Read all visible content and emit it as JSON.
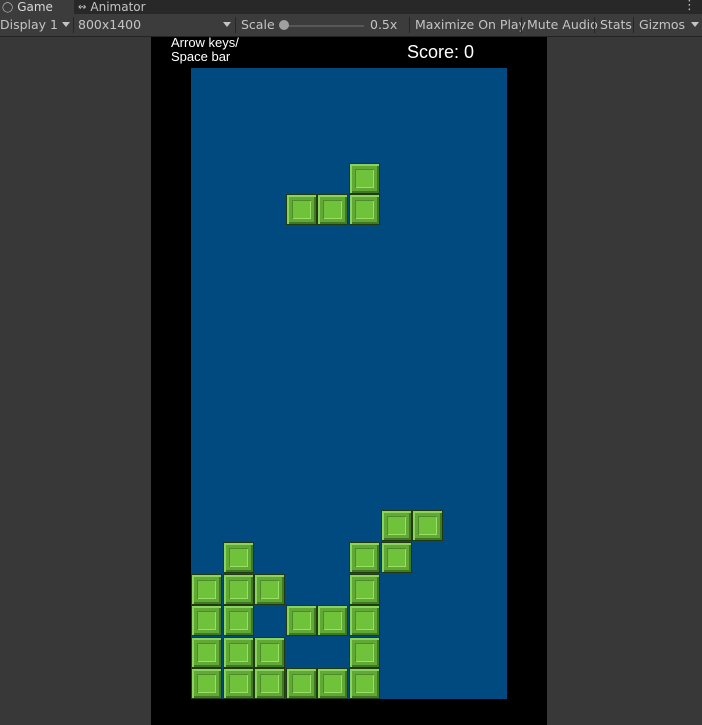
{
  "tabs": [
    {
      "label": "Game",
      "icon": "gamepad-icon",
      "active": true
    },
    {
      "label": "Animator",
      "icon": "animator-icon",
      "active": false
    }
  ],
  "toolbar": {
    "display": "Display 1",
    "resolution": "800x1400",
    "scale_label": "Scale",
    "scale_value": "0.5x",
    "maximize_on_play": "Maximize On Play",
    "mute_audio": "Mute Audio",
    "stats": "Stats",
    "gizmos": "Gizmos"
  },
  "hud": {
    "controls_line1": "Arrow keys/",
    "controls_line2": "Space bar",
    "score": "Score: 0"
  },
  "game": {
    "board_cols": 10,
    "board_rows": 20,
    "colors": {
      "board": "#004a80",
      "block": "#62a836",
      "frame": "#000000"
    },
    "active_piece": {
      "type": "L",
      "cells": [
        [
          5,
          3
        ],
        [
          3,
          4
        ],
        [
          4,
          4
        ],
        [
          5,
          4
        ]
      ]
    },
    "settled_cells": [
      [
        6,
        14
      ],
      [
        7,
        14
      ],
      [
        1,
        15
      ],
      [
        5,
        15
      ],
      [
        6,
        15
      ],
      [
        0,
        16
      ],
      [
        1,
        16
      ],
      [
        2,
        16
      ],
      [
        5,
        16
      ],
      [
        0,
        17
      ],
      [
        1,
        17
      ],
      [
        3,
        17
      ],
      [
        4,
        17
      ],
      [
        5,
        17
      ],
      [
        0,
        18
      ],
      [
        1,
        18
      ],
      [
        2,
        18
      ],
      [
        5,
        18
      ],
      [
        0,
        19
      ],
      [
        1,
        19
      ],
      [
        2,
        19
      ],
      [
        3,
        19
      ],
      [
        4,
        19
      ],
      [
        5,
        19
      ]
    ]
  }
}
